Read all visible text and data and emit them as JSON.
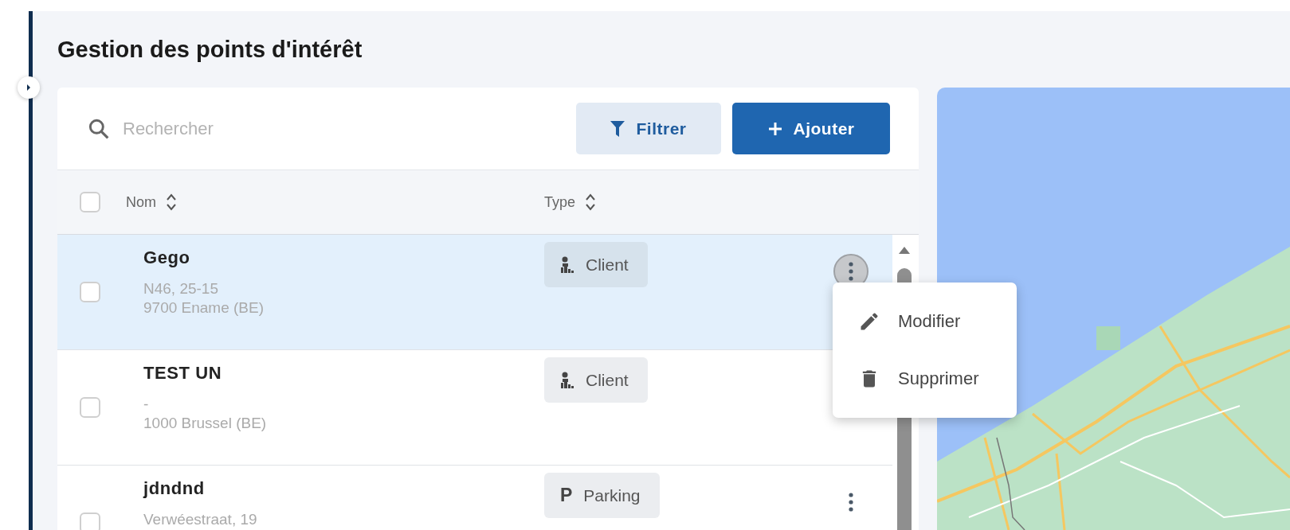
{
  "page": {
    "title": "Gestion des points d'intérêt"
  },
  "toolbar": {
    "search": {
      "placeholder": "Rechercher"
    },
    "buttons": [
      {
        "label": "Filtrer",
        "kind": "filter"
      },
      {
        "label": "Ajouter",
        "kind": "add"
      }
    ]
  },
  "table": {
    "select_all": {
      "checked": false
    },
    "columns": [
      "Nom",
      "Type"
    ],
    "rows": [
      {
        "name": "Gego",
        "address": [
          "N46, 25-15",
          "9700 Ename (BE)"
        ],
        "type": {
          "label": "Client",
          "kind": "client"
        },
        "checked": false,
        "selected": true,
        "menu_open": true
      },
      {
        "name": "TEST UN",
        "address": [
          "-",
          "1000 Brussel (BE)"
        ],
        "type": {
          "label": "Client",
          "kind": "client"
        },
        "checked": false,
        "selected": false
      },
      {
        "name": "jdndnd",
        "address": [
          "Verwéestraat, 19"
        ],
        "type": {
          "label": "Parking",
          "kind": "parking",
          "symbol": "P"
        },
        "checked": false,
        "selected": false,
        "menu_open": false
      }
    ]
  },
  "context_menu": {
    "items": [
      {
        "label": "Modifier",
        "kind": "edit"
      },
      {
        "label": "Supprimer",
        "kind": "delete"
      }
    ]
  }
}
